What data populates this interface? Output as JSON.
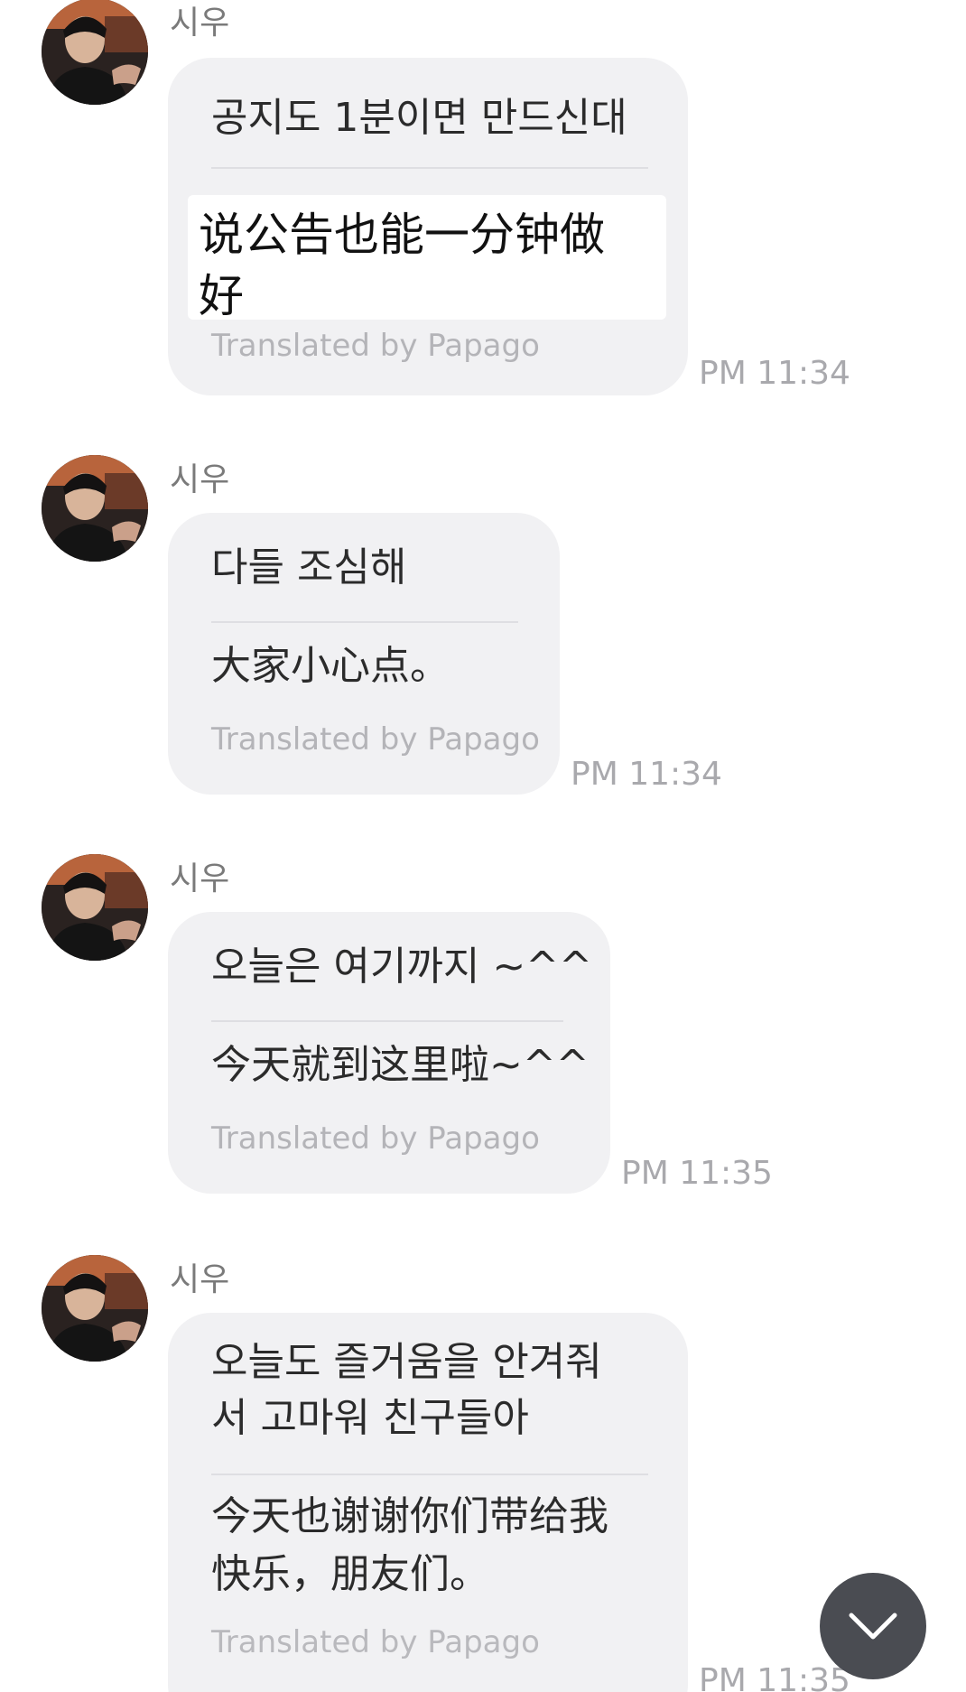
{
  "messages": [
    {
      "sender": "시우",
      "original": "공지도 1분이면 만드신대",
      "translation": "说公告也能一分钟做好",
      "translation_lines": [
        "说公告也能一分钟做",
        "好"
      ],
      "credit": "Translated by Papago",
      "time": "PM 11:34",
      "highlighted": true
    },
    {
      "sender": "시우",
      "original": "다들 조심해",
      "translation": "大家小心点。",
      "credit": "Translated by Papago",
      "time": "PM 11:34"
    },
    {
      "sender": "시우",
      "original": "오늘은 여기까지 ~^^",
      "translation": "今天就到这里啦~^^",
      "credit": "Translated by Papago",
      "time": "PM 11:35"
    },
    {
      "sender": "시우",
      "original": "오늘도 즐거움을 안겨줘 서 고마워 친구들아",
      "original_lines": [
        "오늘도 즐거움을 안겨줘",
        "서 고마워 친구들아"
      ],
      "translation": "今天也谢谢你们带给我快乐，朋友们。",
      "translation_lines": [
        "今天也谢谢你们带给我",
        "快乐，朋友们。"
      ],
      "credit": "Translated by Papago",
      "time": "PM 11:35"
    }
  ],
  "scroll_down_icon": "chevron-down-icon",
  "colors": {
    "bubble": "#f1f1f3",
    "text": "#2b2b2b",
    "muted": "#a9a9ad",
    "fab": "#4a4c52"
  }
}
